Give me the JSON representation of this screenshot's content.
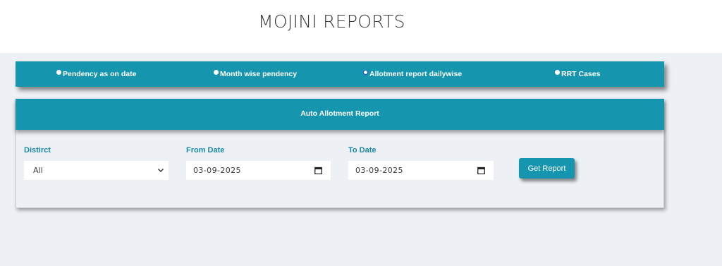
{
  "header": {
    "title": "MOJINI REPORTS"
  },
  "tabs": [
    {
      "label": "Pendency as on date",
      "selected": false
    },
    {
      "label": "Month wise pendency",
      "selected": false
    },
    {
      "label": "Allotment report dailywise",
      "selected": true
    },
    {
      "label": "RRT Cases",
      "selected": false
    }
  ],
  "report": {
    "title": "Auto Allotment Report",
    "district": {
      "label": "Distirct",
      "value": "All"
    },
    "from_date": {
      "label": "From Date",
      "value": "03-09-2025"
    },
    "to_date": {
      "label": "To Date",
      "value": "03-09-2025"
    },
    "button_label": "Get Report"
  },
  "colors": {
    "accent": "#1595ae",
    "label": "#1a8aa3",
    "background": "#edf0f5"
  },
  "icons": {
    "select_arrow": "chevron-down-icon",
    "date_picker": "calendar-icon",
    "tab_radio": "radio-icon"
  }
}
